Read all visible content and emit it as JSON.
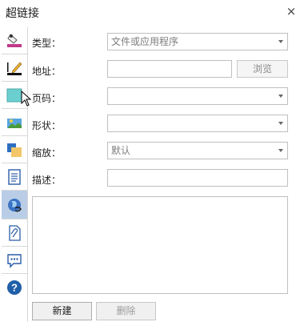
{
  "window": {
    "title": "超链接",
    "close_label": "×"
  },
  "toolbar": {
    "items": [
      {
        "icon": "paint-fill-icon"
      },
      {
        "icon": "line-pen-icon"
      },
      {
        "icon": "fill-color-icon"
      },
      {
        "icon": "picture-icon"
      },
      {
        "icon": "arrange-shapes-icon"
      },
      {
        "icon": "document-list-icon"
      },
      {
        "icon": "hyperlink-globe-icon",
        "selected": true
      },
      {
        "icon": "attachment-icon"
      },
      {
        "icon": "comment-icon"
      },
      {
        "icon": "help-icon"
      }
    ]
  },
  "form": {
    "type_label": "类型：",
    "type_value": "文件或应用程序",
    "address_label": "地址：",
    "address_value": "",
    "browse_label": "浏览",
    "page_label": "页码：",
    "page_value": "",
    "shape_label": "形状：",
    "shape_value": "",
    "zoom_label": "缩放：",
    "zoom_value": "默认",
    "desc_label": "描述：",
    "desc_value": ""
  },
  "buttons": {
    "new_label": "新建",
    "delete_label": "删除"
  },
  "colors": {
    "selected_bg": "#b9cde6",
    "border": "#bfbfbf",
    "help_blue": "#1f5fa8"
  }
}
